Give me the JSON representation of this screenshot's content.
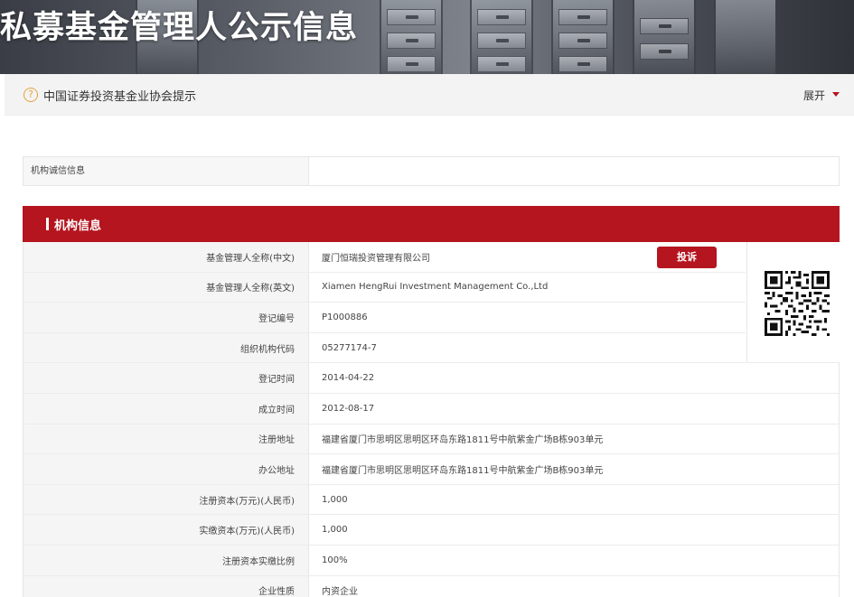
{
  "banner": {
    "title": "私募基金管理人公示信息"
  },
  "notice": {
    "icon": "question-circle-icon",
    "text": "中国证券投资基金业协会提示",
    "expand_label": "展开"
  },
  "integrity": {
    "label": "机构诚信信息",
    "value": ""
  },
  "section": {
    "title": "机构信息"
  },
  "complain_button": "投诉",
  "rows": [
    {
      "key": "基金管理人全称(中文)",
      "value": "厦门恒瑞投资管理有限公司"
    },
    {
      "key": "基金管理人全称(英文)",
      "value": "Xiamen HengRui Investment Management Co.,Ltd"
    },
    {
      "key": "登记编号",
      "value": "P1000886"
    },
    {
      "key": "组织机构代码",
      "value": "05277174-7"
    },
    {
      "key": "登记时间",
      "value": "2014-04-22"
    },
    {
      "key": "成立时间",
      "value": "2012-08-17"
    },
    {
      "key": "注册地址",
      "value": "福建省厦门市思明区思明区环岛东路1811号中航紫金广场B栋903单元"
    },
    {
      "key": "办公地址",
      "value": "福建省厦门市思明区思明区环岛东路1811号中航紫金广场B栋903单元"
    },
    {
      "key": "注册资本(万元)(人民币)",
      "value": "1,000"
    },
    {
      "key": "实缴资本(万元)(人民币)",
      "value": "1,000"
    },
    {
      "key": "注册资本实缴比例",
      "value": "100%"
    },
    {
      "key": "企业性质",
      "value": "内资企业"
    }
  ],
  "colors": {
    "accent": "#b5151e",
    "notice_icon": "#e3a33a"
  }
}
